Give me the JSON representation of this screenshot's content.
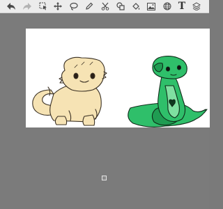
{
  "toolbar": {
    "text_tool_glyph": "T",
    "tools": [
      {
        "name": "undo-icon",
        "enabled": true
      },
      {
        "name": "redo-icon",
        "enabled": false
      },
      {
        "name": "select-icon",
        "enabled": true
      },
      {
        "name": "move-icon",
        "enabled": true
      },
      {
        "name": "lasso-icon",
        "enabled": true
      },
      {
        "name": "pencil-icon",
        "enabled": true
      },
      {
        "name": "cut-icon",
        "enabled": true
      },
      {
        "name": "shapes-icon",
        "enabled": true
      },
      {
        "name": "fill-icon",
        "enabled": true
      },
      {
        "name": "image-icon",
        "enabled": true
      },
      {
        "name": "globe-icon",
        "enabled": true
      },
      {
        "name": "text-icon",
        "enabled": true
      },
      {
        "name": "layers-icon",
        "enabled": true
      }
    ]
  },
  "canvas": {
    "background": "#ffffff",
    "drawings": [
      {
        "name": "bearded-dragon-drawing",
        "color": "#f6e3b4"
      },
      {
        "name": "green-snake-drawing",
        "color": "#2fbf6a"
      }
    ]
  },
  "colors": {
    "workspace": "#7b7b7b",
    "toolbar": "#ececec",
    "icon": "#4a4a4a",
    "icon_disabled": "#b3b3b3"
  }
}
